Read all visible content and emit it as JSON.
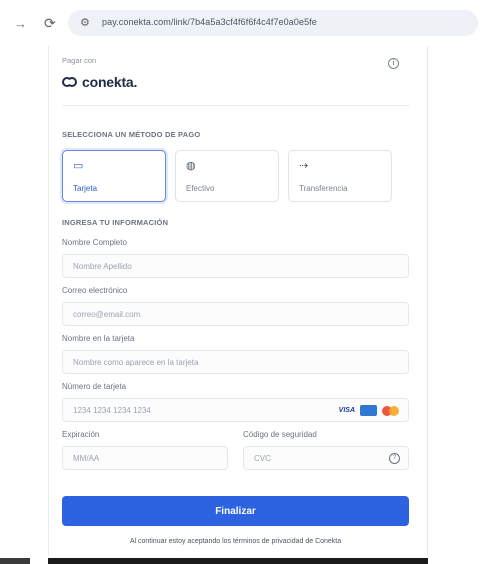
{
  "browser": {
    "nav_forward_icon": "arrow-right-icon",
    "reload_icon": "reload-icon",
    "url": "pay.conekta.com/link/7b4a5a3cf4f6f6f4c4f7e0a0e5fe"
  },
  "checkout": {
    "secure_label": "Pagar con",
    "brand_name": "conekta.",
    "methods_heading": "Selecciona un método de pago",
    "methods": [
      {
        "label": "Tarjeta",
        "icon": "card-icon",
        "selected": true
      },
      {
        "label": "Efectivo",
        "icon": "cash-icon",
        "selected": false
      },
      {
        "label": "Transferencia",
        "icon": "transfer-icon",
        "selected": false
      }
    ],
    "info_heading": "Ingresa tu información",
    "fields": {
      "name": {
        "label": "Nombre Completo",
        "placeholder": "Nombre Apellido"
      },
      "email": {
        "label": "Correo electrónico",
        "placeholder": "correo@email.com"
      },
      "cardholder": {
        "label": "Nombre en la tarjeta",
        "placeholder": "Nombre como aparece en la tarjeta"
      },
      "card_number": {
        "label": "Número de tarjeta",
        "placeholder": "1234 1234 1234 1234"
      },
      "expiry": {
        "label": "Expiración",
        "placeholder": "MM/AA"
      },
      "cvc": {
        "label": "Código de seguridad",
        "placeholder": "CVC"
      }
    },
    "card_brands": [
      "VISA",
      "AMEX",
      "Mastercard"
    ],
    "submit_label": "Finalizar",
    "terms_text": "Al continuar estoy aceptando los términos de privacidad de Conekta"
  },
  "colors": {
    "accent": "#2d63e0",
    "selected_border": "#6b86d6",
    "brand": "#1f2a44"
  }
}
